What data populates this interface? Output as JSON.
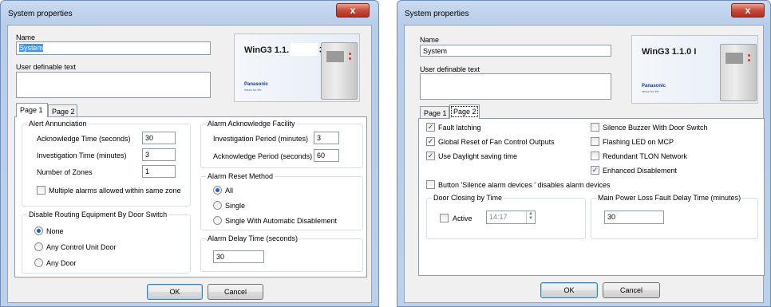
{
  "left": {
    "title": "System properties",
    "close_glyph": "x",
    "name_label": "Name",
    "name_value": "System",
    "udt_label": "User definable text",
    "logo_version": "WinG3 1.1.",
    "logo_version_tail": "3",
    "logo_brand": "Panasonic",
    "logo_slogan": "ideas for life",
    "tabs": [
      "Page 1",
      "Page 2"
    ],
    "alert": {
      "title": "Alert Annunciation",
      "ack_label": "Acknowledge Time (seconds)",
      "ack_value": "30",
      "inv_label": "Investigation Time (minutes)",
      "inv_value": "3",
      "zones_label": "Number of Zones",
      "zones_value": "1",
      "multi_label": "Multiple alarms allowed within same zone"
    },
    "facility": {
      "title": "Alarm Acknowledge Facility",
      "inv_label": "Investigation Period (minutes)",
      "inv_value": "3",
      "ack_label": "Acknowledge Period (seconds)",
      "ack_value": "60"
    },
    "reset": {
      "title": "Alarm Reset Method",
      "options": [
        "All",
        "Single",
        "Single With Automatic Disablement"
      ],
      "selected": "All"
    },
    "routing": {
      "title": "Disable Routing Equipment By Door Switch",
      "options": [
        "None",
        "Any Control Unit Door",
        "Any Door"
      ],
      "selected": "None"
    },
    "delay": {
      "title": "Alarm Delay Time (seconds)",
      "value": "30"
    },
    "ok_label": "OK",
    "cancel_label": "Cancel"
  },
  "right": {
    "title": "System properties",
    "close_glyph": "x",
    "name_label": "Name",
    "name_value": "System",
    "udt_label": "User definable text",
    "logo_version": "WinG3 1.1.0 I",
    "logo_brand": "Panasonic",
    "logo_slogan": "ideas for life",
    "tabs": [
      "Page 1",
      "Page 2"
    ],
    "checks_left": [
      {
        "label": "Fault latching",
        "checked": true
      },
      {
        "label": "Global Reset of Fan Control Outputs",
        "checked": true
      },
      {
        "label": "Use Daylight saving time",
        "checked": true
      }
    ],
    "checks_right": [
      {
        "label": "Silence Buzzer With Door Switch",
        "checked": false
      },
      {
        "label": "Flashing LED on MCP",
        "checked": false
      },
      {
        "label": "Redundant TLON Network",
        "checked": false
      },
      {
        "label": "Enhanced Disablement",
        "checked": true
      }
    ],
    "silence_label": "Button 'Silence alarm devices ' disables alarm devices",
    "door": {
      "title": "Door Closing by Time",
      "active_label": "Active",
      "time_value": "14:17"
    },
    "power": {
      "title": "Main Power Loss Fault Delay Time (minutes)",
      "value": "30"
    },
    "ok_label": "OK",
    "cancel_label": "Cancel"
  }
}
